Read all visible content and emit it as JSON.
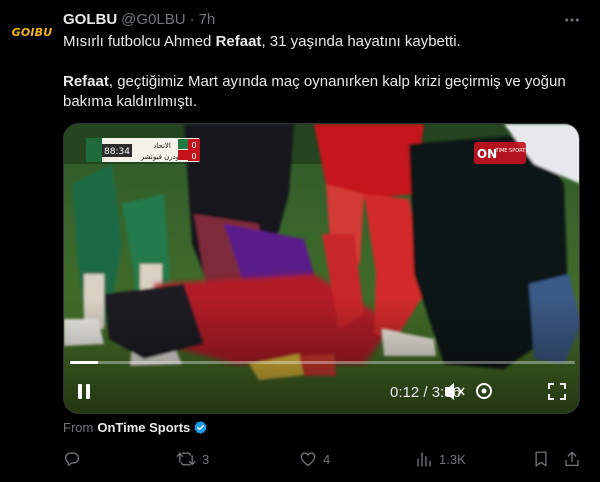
{
  "account": {
    "avatar_text": "GOIBU",
    "name": "GOLBU",
    "handle": "@G0LBU",
    "separator": "·",
    "time": "7h"
  },
  "tweet": {
    "line1_pre": "Mısırlı futbolcu Ahmed ",
    "line1_bold": "Refaat",
    "line1_post": ", 31 yaşında hayatını kaybetti.",
    "line2_bold": "Refaat",
    "line2_post": ", geçtiğimiz Mart ayında maç oynanırken kalp krizi geçirmiş ve yoğun",
    "line3": "bakıma kaldırılmıştı."
  },
  "video": {
    "scoreboard_time": "88:34",
    "team1_score": "0",
    "team2_score": "0",
    "team1_name": "الاتحاد",
    "team2_name": "مودرن فيوتشر",
    "channel_logo": "ON",
    "channel_sub": "TIME SPORTS",
    "progress_fraction": 0.056,
    "current_time": "0:12",
    "time_separator": "/",
    "duration": "3:56",
    "icons": [
      "play-icon",
      "mute-icon",
      "settings-icon",
      "fullscreen-icon"
    ]
  },
  "source": {
    "label": "From",
    "name": "OnTime Sports",
    "verified_color": "#1d9bf0"
  },
  "actions": {
    "reply_count": "",
    "retweet_count": "3",
    "like_count": "4",
    "views_count": "1.3K"
  },
  "colors": {
    "text_primary": "#e7e9ea",
    "text_secondary": "#71767b",
    "background": "#000000",
    "brand_gold": "#f2b51d"
  }
}
